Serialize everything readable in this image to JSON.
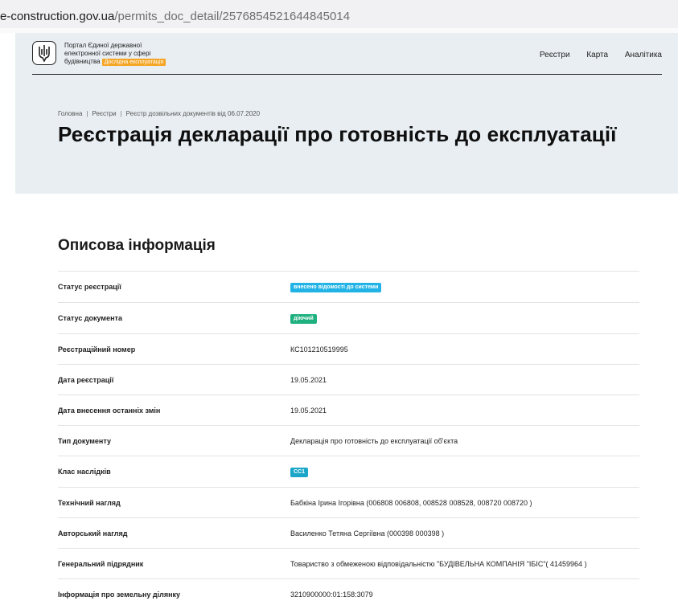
{
  "browser": {
    "url_host": "e-construction.gov.ua",
    "url_path": "/permits_doc_detail/2576854521644845014"
  },
  "colors": {
    "header_bg": "#e8eef2",
    "badge_orange": "#f5a524",
    "status_blue": "#21b3e6",
    "status_green": "#1fb07f",
    "class_teal": "#1aa6c9"
  },
  "brand": {
    "line1": "Портал Єдиної державної",
    "line2": "електронної системи у сфері",
    "line3": "будівництва",
    "badge": "Дослідна експлуатація",
    "logo_icon": "trident-icon"
  },
  "nav": {
    "registries": "Реєстри",
    "map": "Карта",
    "analytics": "Аналітика"
  },
  "breadcrumb": {
    "home": "Головна",
    "registries": "Реєстри",
    "current": "Реєстр дозвільних документів від 06.07.2020"
  },
  "page_title": "Реєстрація декларації про готовність до експлуатації",
  "section_title": "Описова інформація",
  "rows": [
    {
      "label": "Статус реєстрації",
      "value": "внесено відомості до системи"
    },
    {
      "label": "Статус документа",
      "value": "діючий"
    },
    {
      "label": "Реєстраційний номер",
      "value": "КС101210519995"
    },
    {
      "label": "Дата реєстрації",
      "value": "19.05.2021"
    },
    {
      "label": "Дата внесення останніх змін",
      "value": "19.05.2021"
    },
    {
      "label": "Тип документу",
      "value": "Декларація про готовність до експлуатації об'єкта"
    },
    {
      "label": "Клас наслідків",
      "value": "СС1"
    },
    {
      "label": "Технічний нагляд",
      "value": "Бабкіна Ірина Ігорівна (006808 006808, 008528 008528, 008720 008720 )"
    },
    {
      "label": "Авторський нагляд",
      "value": "Василенко Тетяна Сергіївна (000398 000398 )"
    },
    {
      "label": "Генеральний підрядник",
      "value": "Товариство з обмеженою відповідальністю \"БУДІВЕЛЬНА КОМПАНІЯ \"ІБІС\"( 41459964 )"
    },
    {
      "label": "Інформація про земельну ділянку",
      "value": "3210900000:01:158:3079"
    }
  ]
}
